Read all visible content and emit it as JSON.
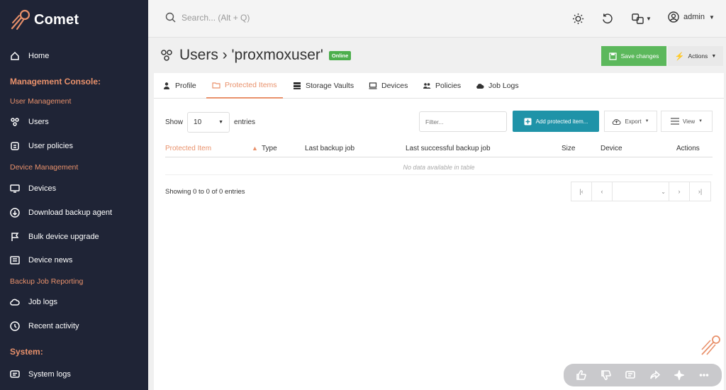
{
  "brand": {
    "name": "Comet",
    "accent": "#e9916b",
    "sidebar_bg": "#1f2436"
  },
  "sidebar": {
    "home": "Home",
    "sections": [
      {
        "heading": "Management Console:"
      },
      {
        "heading": "System:"
      }
    ],
    "subheadings": [
      "User Management",
      "Device Management",
      "Backup Job Reporting"
    ],
    "items": [
      {
        "label": "Users",
        "icon": "users-icon"
      },
      {
        "label": "User policies",
        "icon": "policy-icon"
      },
      {
        "label": "Devices",
        "icon": "monitor-icon"
      },
      {
        "label": "Download backup agent",
        "icon": "download-icon"
      },
      {
        "label": "Bulk device upgrade",
        "icon": "flag-icon"
      },
      {
        "label": "Device news",
        "icon": "news-icon"
      },
      {
        "label": "Job logs",
        "icon": "cloud-icon"
      },
      {
        "label": "Recent activity",
        "icon": "clock-icon"
      },
      {
        "label": "System logs",
        "icon": "chat-icon"
      }
    ]
  },
  "topbar": {
    "search_placeholder": "Search... (Alt + Q)",
    "user": "admin"
  },
  "page": {
    "title": "Users › 'proxmoxuser'",
    "status_badge": "Online",
    "save_label": "Save changes",
    "actions_label": "Actions"
  },
  "tabs": [
    {
      "label": "Profile",
      "active": false
    },
    {
      "label": "Protected Items",
      "active": true
    },
    {
      "label": "Storage Vaults",
      "active": false
    },
    {
      "label": "Devices",
      "active": false
    },
    {
      "label": "Policies",
      "active": false
    },
    {
      "label": "Job Logs",
      "active": false
    }
  ],
  "table_controls": {
    "show_label": "Show",
    "page_size": "10",
    "entries_label": "entries",
    "filter_placeholder": "Filter...",
    "add_label": "Add protected item...",
    "export_label": "Export",
    "view_label": "View"
  },
  "table": {
    "columns": [
      "Protected Item",
      "Type",
      "Last backup job",
      "Last successful backup job",
      "Size",
      "Device",
      "Actions"
    ],
    "empty_message": "No data available in table",
    "info": "Showing 0 to 0 of 0 entries"
  },
  "pager": {
    "first": "|‹",
    "prev": "‹",
    "next": "›",
    "last": "›|"
  }
}
